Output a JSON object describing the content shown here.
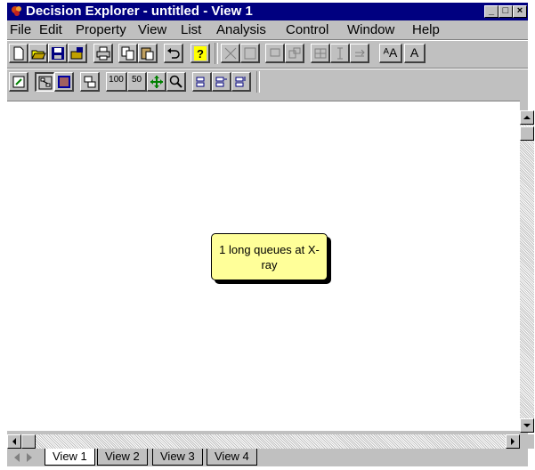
{
  "window": {
    "title": "Decision Explorer - untitled - View 1",
    "controls": {
      "minimize": "_",
      "maximize": "□",
      "close": "×"
    }
  },
  "menu": [
    {
      "label": "File"
    },
    {
      "label": "Edit"
    },
    {
      "label": "Property"
    },
    {
      "label": "View"
    },
    {
      "label": "List"
    },
    {
      "label": "Analysis"
    },
    {
      "label": "Control"
    },
    {
      "label": "Window"
    },
    {
      "label": "Help"
    }
  ],
  "toolbar1": {
    "text_buttons": {
      "font_larger": "ᴬA",
      "font_smaller": "A"
    }
  },
  "toolbar2": {
    "zoom_100": "100",
    "zoom_50": "50"
  },
  "node": {
    "text": "1 long queues at X-ray",
    "fill": "#ffff99"
  },
  "tabs": [
    "View 1",
    "View 2",
    "View 3",
    "View 4"
  ],
  "active_tab": "View 1",
  "colors": {
    "titlebar": "#000080",
    "face": "#c0c0c0",
    "node": "#ffff99"
  }
}
